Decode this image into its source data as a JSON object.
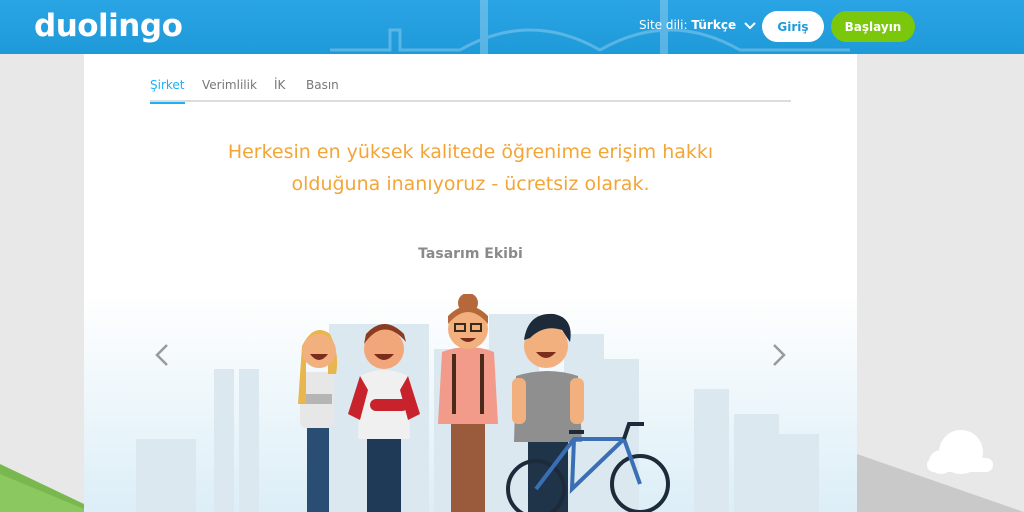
{
  "header": {
    "logo": "duolingo",
    "site_language_label": "Site dili:",
    "site_language_value": "Türkçe",
    "login_label": "Giriş",
    "start_label": "Başlayın"
  },
  "tabs": [
    {
      "label": "Şirket",
      "active": true
    },
    {
      "label": "Verimlilik",
      "active": false
    },
    {
      "label": "İK",
      "active": false
    },
    {
      "label": "Basın",
      "active": false
    }
  ],
  "main": {
    "headline_line1": "Herkesin en yüksek kalitede öğrenime erişim hakkı",
    "headline_line2": "olduğuna inanıyoruz - ücretsiz olarak.",
    "team_title": "Tasarım Ekibi"
  },
  "colors": {
    "brand_blue": "#1cb0f6",
    "brand_green": "#7ac70c",
    "headline_orange": "#f3a536"
  },
  "icons": [
    "chevron-down-icon",
    "chevron-left-icon",
    "chevron-right-icon"
  ]
}
